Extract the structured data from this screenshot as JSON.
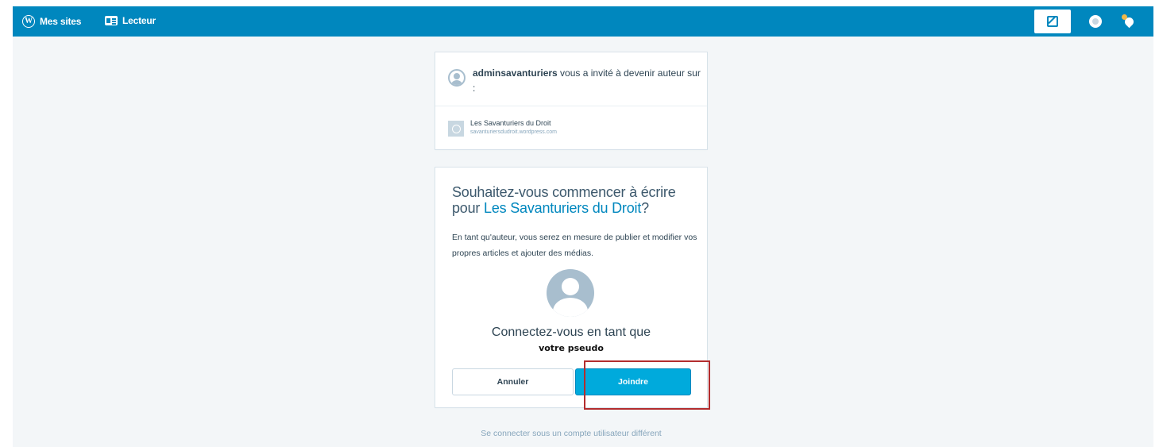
{
  "masterbar": {
    "my_sites_label": "Mes sites",
    "reader_label": "Lecteur",
    "icons": [
      "wordpress-logo-icon",
      "reader-icon",
      "write-post-icon",
      "user-avatar-icon",
      "notifications-icon"
    ]
  },
  "invite": {
    "inviter": "adminsavanturiers",
    "message": " vous a invité à devenir auteur sur :",
    "site_name": "Les Savanturiers du Droit",
    "site_url": "savanturiersdudroit.wordpress.com"
  },
  "join": {
    "title_prefix": "Souhaitez-vous commencer à écrire pour ",
    "title_site": "Les Savanturiers du Droit",
    "title_suffix": "?",
    "description": "En tant qu'auteur, vous serez en mesure de publier et modifier vos propres articles et ajouter des médias.",
    "connect_as": "Connectez-vous en tant que",
    "username": "votre pseudo",
    "cancel_label": "Annuler",
    "join_label": "Joindre"
  },
  "footer": {
    "other_account_link": "Se connecter sous un compte utilisateur différent"
  },
  "colors": {
    "masterbar": "#0087be",
    "primary_button": "#00aadc",
    "highlight_box": "#b32d2e",
    "background": "#f3f6f8"
  }
}
